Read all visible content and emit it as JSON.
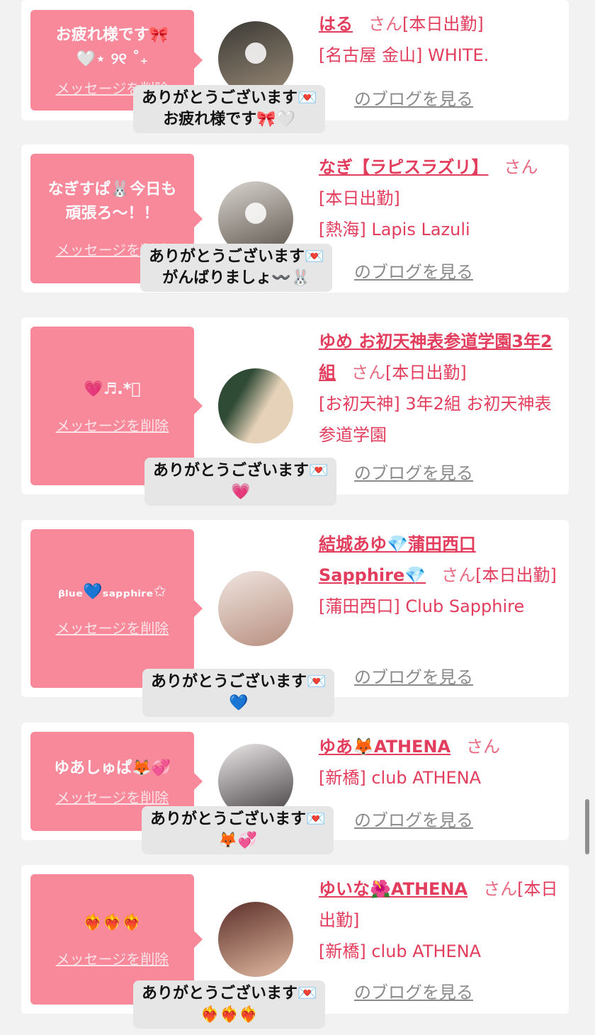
{
  "cards": [
    {
      "bubble_message": "お疲れ様です🎀\n🤍⋆ ୨୧ ˚₊",
      "delete_label": "メッセージを削除",
      "name": "はる",
      "san": "さん",
      "status": "[本日出勤]",
      "shop": "[名古屋 金山] WHITE.",
      "blog_label": "のブログを見る",
      "reply": "ありがとうございます💌\nお疲れ様です🎀🤍",
      "avatar_colors": [
        "#3b3a35",
        "#9a8a78"
      ]
    },
    {
      "bubble_message": "なぎすぱ🐰今日も\n頑張ろ〜！！",
      "delete_label": "メッセージを削除",
      "name": "なぎ【ラピスラズリ】",
      "san": "さん",
      "status": "[本日出勤]",
      "shop": "[熱海] Lapis Lazuli",
      "blog_label": "のブログを見る",
      "reply": "ありがとうございます💌\nがんばりましょ〰️🐰",
      "avatar_colors": [
        "#d9d6cf",
        "#5a514a"
      ]
    },
    {
      "bubble_message": "💗♬.*ﾟ",
      "delete_label": "メッセージを削除",
      "name": "ゆめ お初天神表参道学園3年2組",
      "san": "さん",
      "status": "[本日出勤]",
      "shop": "[お初天神] 3年2組 お初天神表参道学園",
      "blog_label": "のブログを見る",
      "reply": "ありがとうございます💌\n💗",
      "avatar_colors": [
        "#2f4a35",
        "#e5d2b9"
      ]
    },
    {
      "bubble_message": "ᵦₗᵤₑ💙ₛₐₚₚₕᵢᵣₑ✩",
      "delete_label": "メッセージを削除",
      "name": "結城あゆ💎蒲田西口Sapphire💎",
      "san": "さん",
      "status": "[本日出勤]",
      "shop": "[蒲田西口] Club Sapphire",
      "blog_label": "のブログを見る",
      "reply": "ありがとうございます💌\n💙",
      "avatar_colors": [
        "#efe5e0",
        "#b88f7f"
      ]
    },
    {
      "bubble_message": "ゆあしゅぱ🦊💞",
      "delete_label": "メッセージを削除",
      "name": "ゆあ🦊ATHENA",
      "san": "さん",
      "status": "",
      "shop": "[新橋] club ATHENA",
      "blog_label": "のブログを見る",
      "reply": "ありがとうございます💌\n🦊💞",
      "avatar_colors": [
        "#ece8e8",
        "#3f3a3d"
      ]
    },
    {
      "bubble_message": "❤️‍🔥❤️‍🔥❤️‍🔥",
      "delete_label": "メッセージを削除",
      "name": "ゆいな🌺ATHENA",
      "san": "さん",
      "status": "[本日出勤]",
      "shop": "[新橋] club ATHENA",
      "blog_label": "のブログを見る",
      "reply": "ありがとうございます💌\n❤️‍🔥❤️‍🔥❤️‍🔥",
      "avatar_colors": [
        "#5c2f2a",
        "#e0b9a0"
      ]
    }
  ],
  "colors": {
    "bubble": "#f7899a",
    "accent": "#e23d5c",
    "page_bg": "#f2f2f2"
  }
}
